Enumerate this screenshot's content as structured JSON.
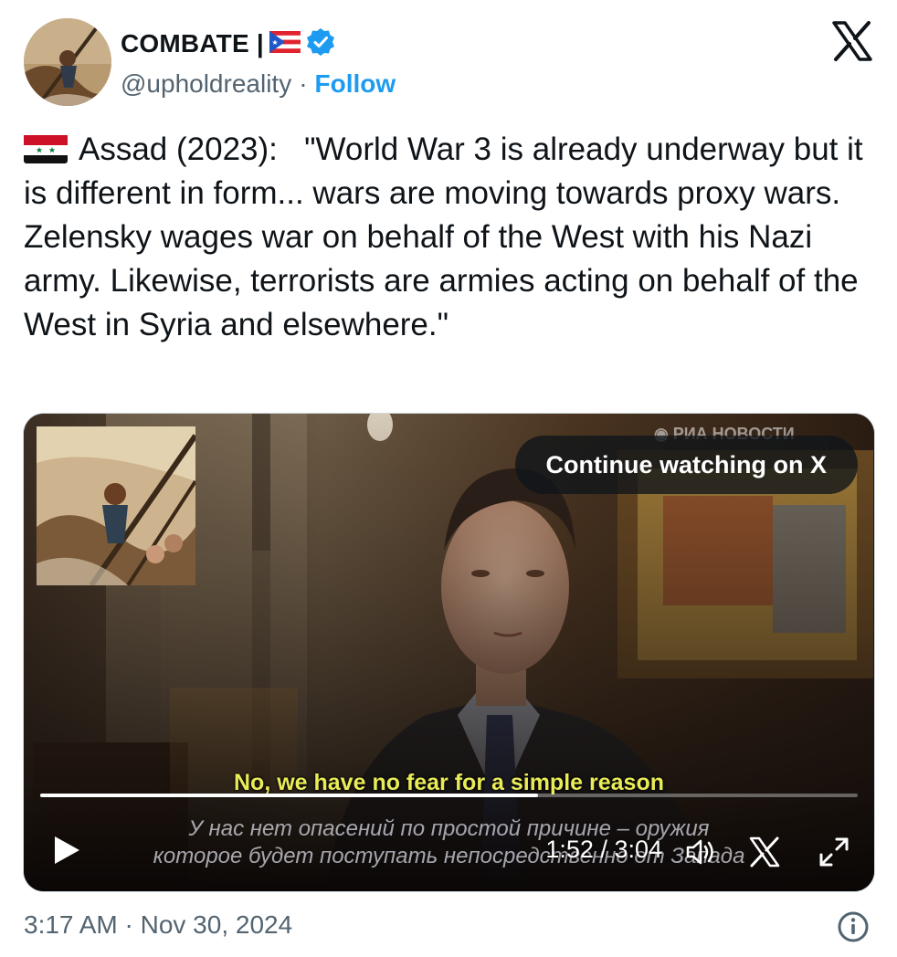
{
  "author": {
    "display_name": "COMBATE |",
    "handle": "@upholdreality",
    "separator": "·",
    "follow_label": "Follow",
    "verified_badge_icon": "verified-badge-icon",
    "flag_icon": "puerto-rico-flag-icon",
    "avatar": "sailor-painting-avatar"
  },
  "brand": {
    "logo_icon": "x-logo-icon"
  },
  "tweet": {
    "flag_icon": "syria-flag-icon",
    "text": "Assad (2023):   \"World War 3 is already underway but it is different in form... wars are moving towards proxy wars. Zelensky wages war on behalf of the West with his Nazi army. Likewise, terrorists are armies acting on behalf of the West in Syria and elsewhere.\""
  },
  "video": {
    "continue_label": "Continue watching on X",
    "subtitle_en": "No, we have no fear for a simple reason",
    "subtitle_ru_line1": "У нас нет опасений по простой причине – оружия",
    "subtitle_ru_line2": "которое будет поступать непосредственно от Запада",
    "current_time": "1:52",
    "duration": "3:04",
    "time_display": "1:52 / 3:04",
    "progress_fraction": 0.609,
    "controls": [
      "play-icon",
      "volume-icon",
      "x-logo-icon",
      "fullscreen-icon"
    ]
  },
  "footer": {
    "timestamp": "3:17 AM · Nov 30, 2024",
    "info_icon": "info-icon"
  },
  "colors": {
    "accent": "#1d9bf0",
    "text": "#0f1419",
    "secondary_text": "#536471",
    "subtitle_yellow": "#e9ec57"
  }
}
